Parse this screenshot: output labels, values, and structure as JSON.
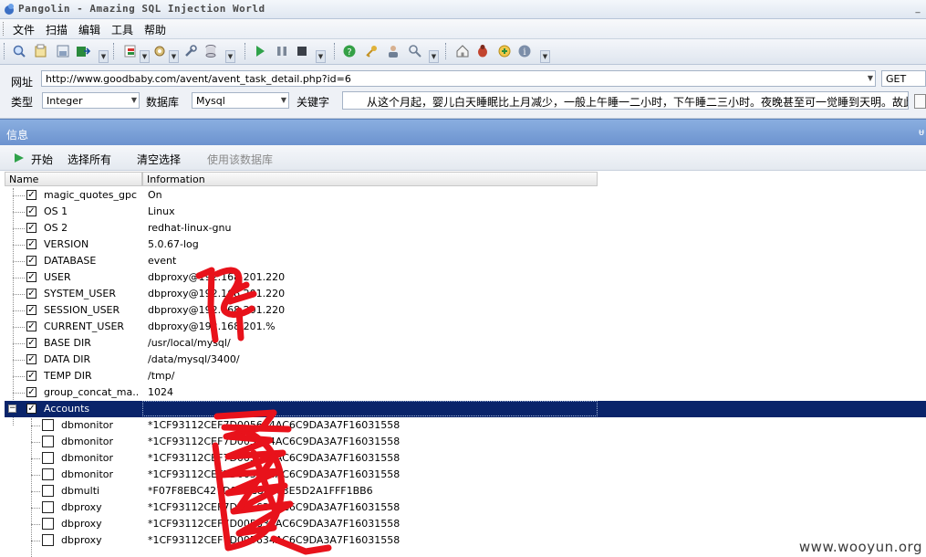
{
  "window": {
    "title": "Pangolin - Amazing SQL Injection World",
    "min_label": "_"
  },
  "menu": [
    "文件",
    "扫描",
    "编辑",
    "工具",
    "帮助"
  ],
  "toolbar_icons": [
    "search-icon",
    "open-icon",
    "save-icon",
    "export-icon",
    "inject-icon",
    "settings-icon",
    "tools-icon",
    "database-icon",
    "play-icon",
    "pause-icon",
    "stop-icon",
    "help-icon",
    "key-icon",
    "user-icon",
    "magnifier-icon",
    "home-icon",
    "bug-icon",
    "update-icon",
    "info-icon"
  ],
  "form": {
    "url_label": "网址",
    "url_value": "http://www.goodbaby.com/avent/avent_task_detail.php?id=6",
    "method_value": "GET",
    "type_label": "类型",
    "type_value": "Integer",
    "db_label": "数据库",
    "db_value": "Mysql",
    "keyword_label": "关键字",
    "keyword_value": "从这个月起，婴儿白天睡眠比上月减少，一般上午睡一二小时，下午睡二三小时。夜晚甚至可一觉睡到天明。故此"
  },
  "panel": {
    "title": "信息",
    "pin": "ᵾ"
  },
  "actions": {
    "start": "开始",
    "select_all": "选择所有",
    "clear_selection": "清空选择",
    "use_database": "使用该数据库"
  },
  "columns": {
    "name": "Name",
    "information": "Information"
  },
  "rows": [
    {
      "name": "magic_quotes_gpc",
      "info": "On",
      "checked": true
    },
    {
      "name": "OS 1",
      "info": "Linux",
      "checked": true
    },
    {
      "name": "OS 2",
      "info": "redhat-linux-gnu",
      "checked": true
    },
    {
      "name": "VERSION",
      "info": "5.0.67-log",
      "checked": true
    },
    {
      "name": "DATABASE",
      "info": "event",
      "checked": true
    },
    {
      "name": "USER",
      "info": "dbproxy@192.168.201.220",
      "checked": true
    },
    {
      "name": "SYSTEM_USER",
      "info": "dbproxy@192.168.201.220",
      "checked": true
    },
    {
      "name": "SESSION_USER",
      "info": "dbproxy@192.168.201.220",
      "checked": true
    },
    {
      "name": "CURRENT_USER",
      "info": "dbproxy@192.168.201.%",
      "checked": true
    },
    {
      "name": "BASE DIR",
      "info": "/usr/local/mysql/",
      "checked": true
    },
    {
      "name": "DATA DIR",
      "info": "/data/mysql/3400/",
      "checked": true
    },
    {
      "name": "TEMP DIR",
      "info": "/tmp/",
      "checked": true
    },
    {
      "name": "group_concat_ma...",
      "info": "1024",
      "checked": true
    },
    {
      "name": "Accounts",
      "info": "",
      "checked": true,
      "selected": true
    }
  ],
  "accounts": [
    {
      "name": "dbmonitor",
      "info": "*1CF93112CEF7D005634AC6C9DA3A7F16031558"
    },
    {
      "name": "dbmonitor",
      "info": "*1CF93112CEF7D005634AC6C9DA3A7F16031558"
    },
    {
      "name": "dbmonitor",
      "info": "*1CF93112CEF7D005634AC6C9DA3A7F16031558"
    },
    {
      "name": "dbmonitor",
      "info": "*1CF93112CEF7D005634AC6C9DA3A7F16031558"
    },
    {
      "name": "dbmulti",
      "info": "*F07F8EBC427D9A0C8B4F3E5D2A1FFF1BB6"
    },
    {
      "name": "dbproxy",
      "info": "*1CF93112CEF7D005634AC6C9DA3A7F16031558"
    },
    {
      "name": "dbproxy",
      "info": "*1CF93112CEF7D005634AC6C9DA3A7F16031558"
    },
    {
      "name": "dbproxy",
      "info": "*1CF93112CEF7D005634AC6C9DA3A7F16031558"
    }
  ],
  "watermark": "www.wooyun.org",
  "colors": {
    "selected_row": "#0a246a",
    "panel_header": "#7aa0d8",
    "redaction": "#e8121b"
  }
}
